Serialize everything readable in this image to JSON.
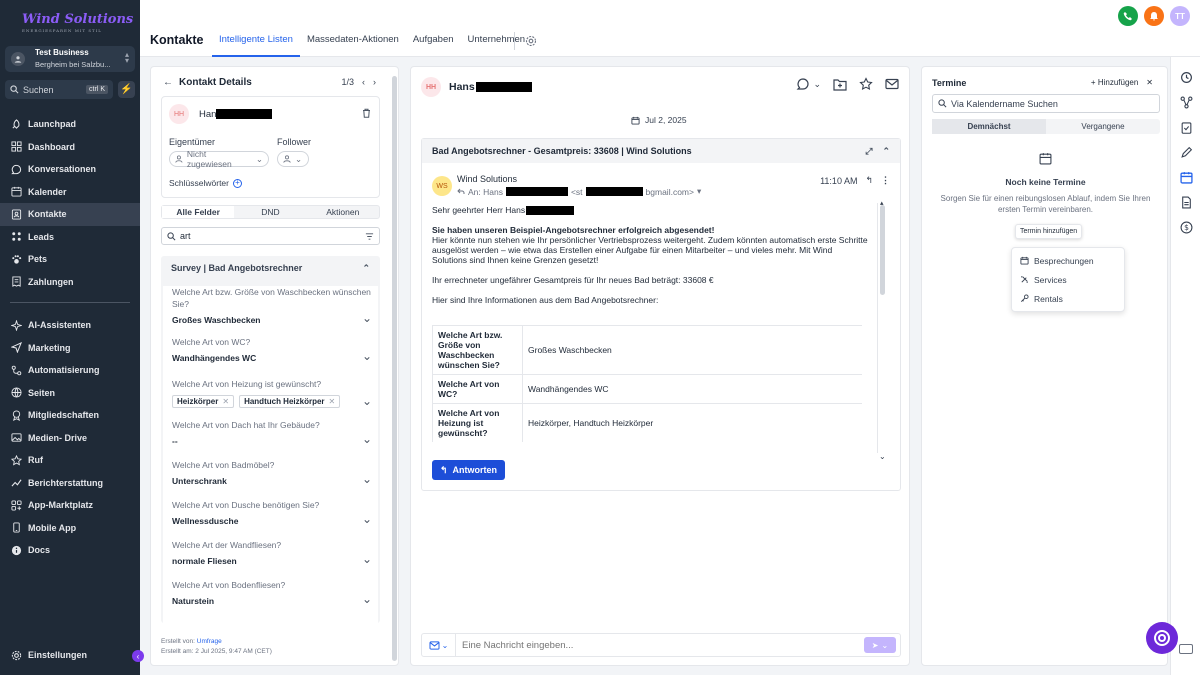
{
  "brand": {
    "name": "Wind Solutions",
    "tagline": "ENERGIESPAREN MIT STIL"
  },
  "business": {
    "name": "Test Business",
    "location": "Bergheim bei Salzbu..."
  },
  "search": {
    "label": "Suchen",
    "shortcut": "ctrl K"
  },
  "sidebar": {
    "items": [
      {
        "label": "Launchpad",
        "icon": "rocket-icon"
      },
      {
        "label": "Dashboard",
        "icon": "grid-icon"
      },
      {
        "label": "Konversationen",
        "icon": "chat-icon"
      },
      {
        "label": "Kalender",
        "icon": "calendar-icon"
      },
      {
        "label": "Kontakte",
        "icon": "contacts-icon"
      },
      {
        "label": "Leads",
        "icon": "leads-icon"
      },
      {
        "label": "Pets",
        "icon": "paw-icon"
      },
      {
        "label": "Zahlungen",
        "icon": "receipt-icon"
      }
    ],
    "items2": [
      {
        "label": "AI-Assistenten",
        "icon": "sparkle-icon"
      },
      {
        "label": "Marketing",
        "icon": "send-icon"
      },
      {
        "label": "Automatisierung",
        "icon": "workflow-icon"
      },
      {
        "label": "Seiten",
        "icon": "globe-icon"
      },
      {
        "label": "Mitgliedschaften",
        "icon": "badge-icon"
      },
      {
        "label": "Medien- Drive",
        "icon": "image-icon"
      },
      {
        "label": "Ruf",
        "icon": "star-icon"
      },
      {
        "label": "Berichterstattung",
        "icon": "chart-icon"
      },
      {
        "label": "App-Marktplatz",
        "icon": "apps-icon"
      },
      {
        "label": "Mobile App",
        "icon": "phone-icon"
      },
      {
        "label": "Docs",
        "icon": "info-icon"
      }
    ],
    "settings": "Einstellungen"
  },
  "header": {
    "title": "Kontakte",
    "tabs": [
      "Intelligente Listen",
      "Massedaten-Aktionen",
      "Aufgaben",
      "Unternehmen"
    ],
    "user_initials": "TT"
  },
  "contact": {
    "panel_title": "Kontakt Details",
    "pager": "1/3",
    "initials": "HH",
    "name_visible": "Han",
    "owner_label": "Eigentümer",
    "owner_value": "Nicht zugewiesen",
    "follower_label": "Follower",
    "keywords_label": "Schlüsselwörter",
    "tabs": [
      "Alle Felder",
      "DND",
      "Aktionen"
    ],
    "field_search": "art",
    "section_title": "Survey | Bad Angebotsrechner",
    "questions": [
      {
        "q": "Welche Art bzw. Größe von Waschbecken wünschen Sie?",
        "a": "Großes Waschbecken"
      },
      {
        "q": "Welche Art von WC?",
        "a": "Wandhängendes WC"
      },
      {
        "q": "Welche Art von Heizung ist gewünscht?",
        "tags": [
          "Heizkörper",
          "Handtuch Heizkörper"
        ]
      },
      {
        "q": "Welche Art von Dach hat Ihr Gebäude?",
        "a": "--"
      },
      {
        "q": "Welche Art von Badmöbel?",
        "a": "Unterschrank"
      },
      {
        "q": "Welche Art von Dusche benötigen Sie?",
        "a": "Wellnessdusche"
      },
      {
        "q": "Welche Art der Wandfliesen?",
        "a": "normale Fliesen"
      },
      {
        "q": "Welche Art von Bodenfliesen?",
        "a": "Naturstein"
      }
    ],
    "created_by_label": "Erstellt von:",
    "created_by": "Umfrage",
    "created_at": "Erstellt am: 2 Jul 2025, 9:47 AM (CET)"
  },
  "conversation": {
    "initials": "HH",
    "name_visible": "Hans",
    "date": "Jul 2, 2025",
    "subject": "Bad Angebotsrechner - Gesamtpreis: 33608 | Wind Solutions",
    "sender": "Wind Solutions",
    "sender_initials": "WS",
    "to_prefix": "An: Hans",
    "to_email_prefix": "<st",
    "to_email_suffix": "bgmail.com>",
    "time": "11:10 AM",
    "greeting": "Sehr geehrter Herr Hans",
    "headline": "Sie haben unseren Beispiel-Angebotsrechner erfolgreich abgesendet!",
    "para1": "Hier könnte nun stehen wie Ihr persönlicher Vertriebsprozess weitergeht. Zudem könnten automatisch erste Schritte ausgelöst werden – wie etwa das Erstellen einer Aufgabe für einen Mitarbeiter – und vieles mehr. Mit Wind Solutions sind Ihnen keine Grenzen gesetzt!",
    "price_line": "Ihr errechneter ungefährer Gesamtpreis für Ihr neues Bad beträgt: 33608 €",
    "info_line": "Hier sind Ihre Informationen aus dem Bad Angebotsrechner:",
    "table": [
      [
        "Welche Art bzw. Größe von Waschbecken wünschen Sie?",
        "Großes Waschbecken"
      ],
      [
        "Welche Art von WC?",
        "Wandhängendes WC"
      ],
      [
        "Welche Art von Heizung ist gewünscht?",
        "Heizkörper, Handtuch Heizkörper"
      ]
    ],
    "reply_label": "Antworten",
    "composer_placeholder": "Eine Nachricht eingeben..."
  },
  "appointments": {
    "title": "Termine",
    "add_label": "Hinzufügen",
    "search_placeholder": "Via Kalendername Suchen",
    "tabs": [
      "Demnächst",
      "Vergangene"
    ],
    "empty_title": "Noch keine Termine",
    "empty_desc": "Sorgen Sie für einen reibungslosen Ablauf, indem Sie Ihren ersten Termin vereinbaren.",
    "tooltip": "Termin hinzufügen",
    "menu": [
      {
        "label": "Besprechungen",
        "icon": "calendar-icon"
      },
      {
        "label": "Services",
        "icon": "tools-icon"
      },
      {
        "label": "Rentals",
        "icon": "key-icon"
      }
    ]
  },
  "colors": {
    "sidebar": "#1f2a37",
    "accent": "#2563eb",
    "brand": "#7c3aed",
    "phone": "#16a34a",
    "bell": "#f97316"
  }
}
